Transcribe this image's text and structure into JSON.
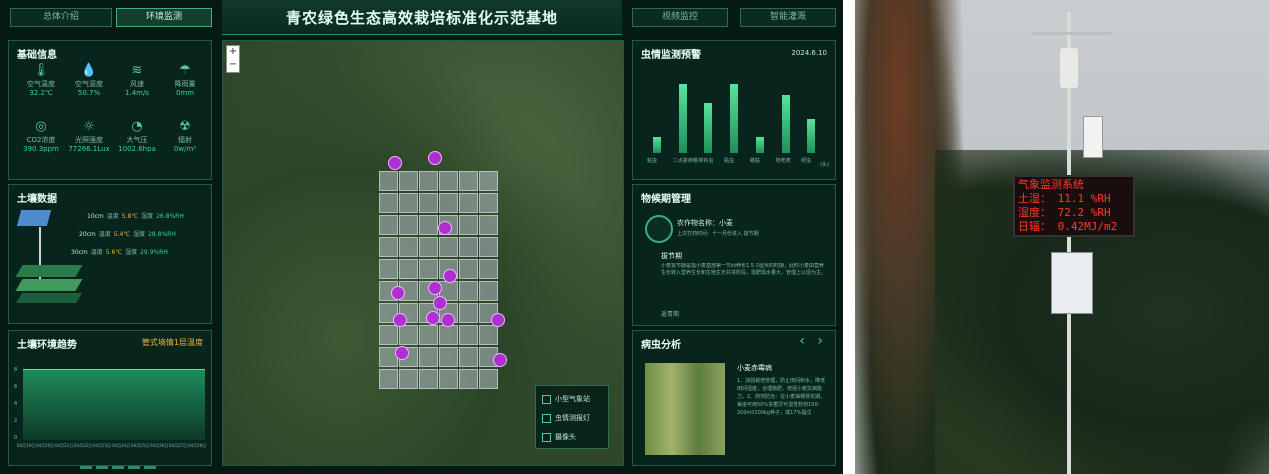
{
  "header": {
    "title": "青农绿色生态高效栽培标准化示范基地",
    "tabs_left": [
      "总体介绍",
      "环境监测"
    ],
    "tabs_right": [
      "视频监控",
      "智能灌溉"
    ],
    "active_tab": "环境监测"
  },
  "basic_info": {
    "title": "基础信息",
    "items": [
      {
        "label": "空气温度",
        "value": "32.2℃",
        "icon": "thermometer-icon"
      },
      {
        "label": "空气湿度",
        "value": "50.7%",
        "icon": "droplet-icon"
      },
      {
        "label": "风速",
        "value": "1.4m/s",
        "icon": "wind-icon"
      },
      {
        "label": "降雨量",
        "value": "0mm",
        "icon": "umbrella-icon"
      },
      {
        "label": "CO2浓度",
        "value": "390.3ppm",
        "icon": "co2-icon"
      },
      {
        "label": "光照强度",
        "value": "77266.1Lux",
        "icon": "sun-icon"
      },
      {
        "label": "大气压",
        "value": "1002.6hpa",
        "icon": "gauge-icon"
      },
      {
        "label": "辐射",
        "value": "0w/m²",
        "icon": "radiation-icon"
      }
    ]
  },
  "soil": {
    "title": "土壤数据",
    "rows": [
      {
        "depth": "10cm",
        "temp_label": "温度",
        "temp": "5.8℃",
        "hum_label": "湿度",
        "hum": "26.8%RH"
      },
      {
        "depth": "20cm",
        "temp_label": "温度",
        "temp": "5.4℃",
        "hum_label": "湿度",
        "hum": "28.8%RH"
      },
      {
        "depth": "30cm",
        "temp_label": "温度",
        "temp": "5.6℃",
        "hum_label": "湿度",
        "hum": "29.9%RH"
      }
    ]
  },
  "soil_trend": {
    "title": "土壤环境趋势",
    "subtitle": "管式墒情1层温度",
    "y_ticks": [
      "8",
      "6",
      "4",
      "2",
      "0"
    ],
    "x_ticks": [
      "04月19日",
      "04月20日",
      "04月21日",
      "04月22日",
      "04月23日",
      "04月24日",
      "04月25日",
      "04月26日",
      "04月27日",
      "04月28日"
    ]
  },
  "pest": {
    "title": "虫情监测预警",
    "date": "2024.6.10",
    "unit": "(头)"
  },
  "chart_data": {
    "type": "bar",
    "categories": [
      "粘虫",
      "二点委夜蛾",
      "棉铃虫",
      "黏虫",
      "蝼蛄",
      "地老虎",
      "蚜虫"
    ],
    "values": [
      1.0,
      4.3,
      3.1,
      4.3,
      1.0,
      3.6,
      2.1
    ],
    "ylim": [
      0,
      5
    ]
  },
  "phenology": {
    "title": "物候期管理",
    "crop_label": "农作物名称：小麦",
    "stage_text": "上次打药时间：十一月份进入 拔节期",
    "stage_name": "拔节期",
    "body": "小麦拔节期是指小麦基部第一节间伸长1.5-2厘米的时期，此时小麦由营养生长转入营养生长和生殖生长并进阶段，需肥需水量大，管理上以促为主。",
    "more": "返青期"
  },
  "disease": {
    "title": "病虫分析",
    "name": "小麦赤霉病",
    "text": "1、加强栽培管理，防止田间积水，降低田间湿度，合理施肥，增强小麦抗病能力。2、药剂防治：在小麦抽穗扬花期，每亩可用50%多菌灵可湿性粉剂100-200ml/100kg种子，或17%福戊",
    "nav_prev": "‹",
    "nav_next": "›"
  },
  "map": {
    "zoom_in": "+",
    "zoom_out": "−",
    "legend": [
      "小型气象站",
      "虫情测报灯",
      "摄像头"
    ]
  },
  "photo_sign": {
    "title": "气象监测系统",
    "lines": [
      "土湿：  11.1 %RH",
      "湿度：  72.2 %RH",
      "日辐：  0.42MJ/m2"
    ]
  }
}
